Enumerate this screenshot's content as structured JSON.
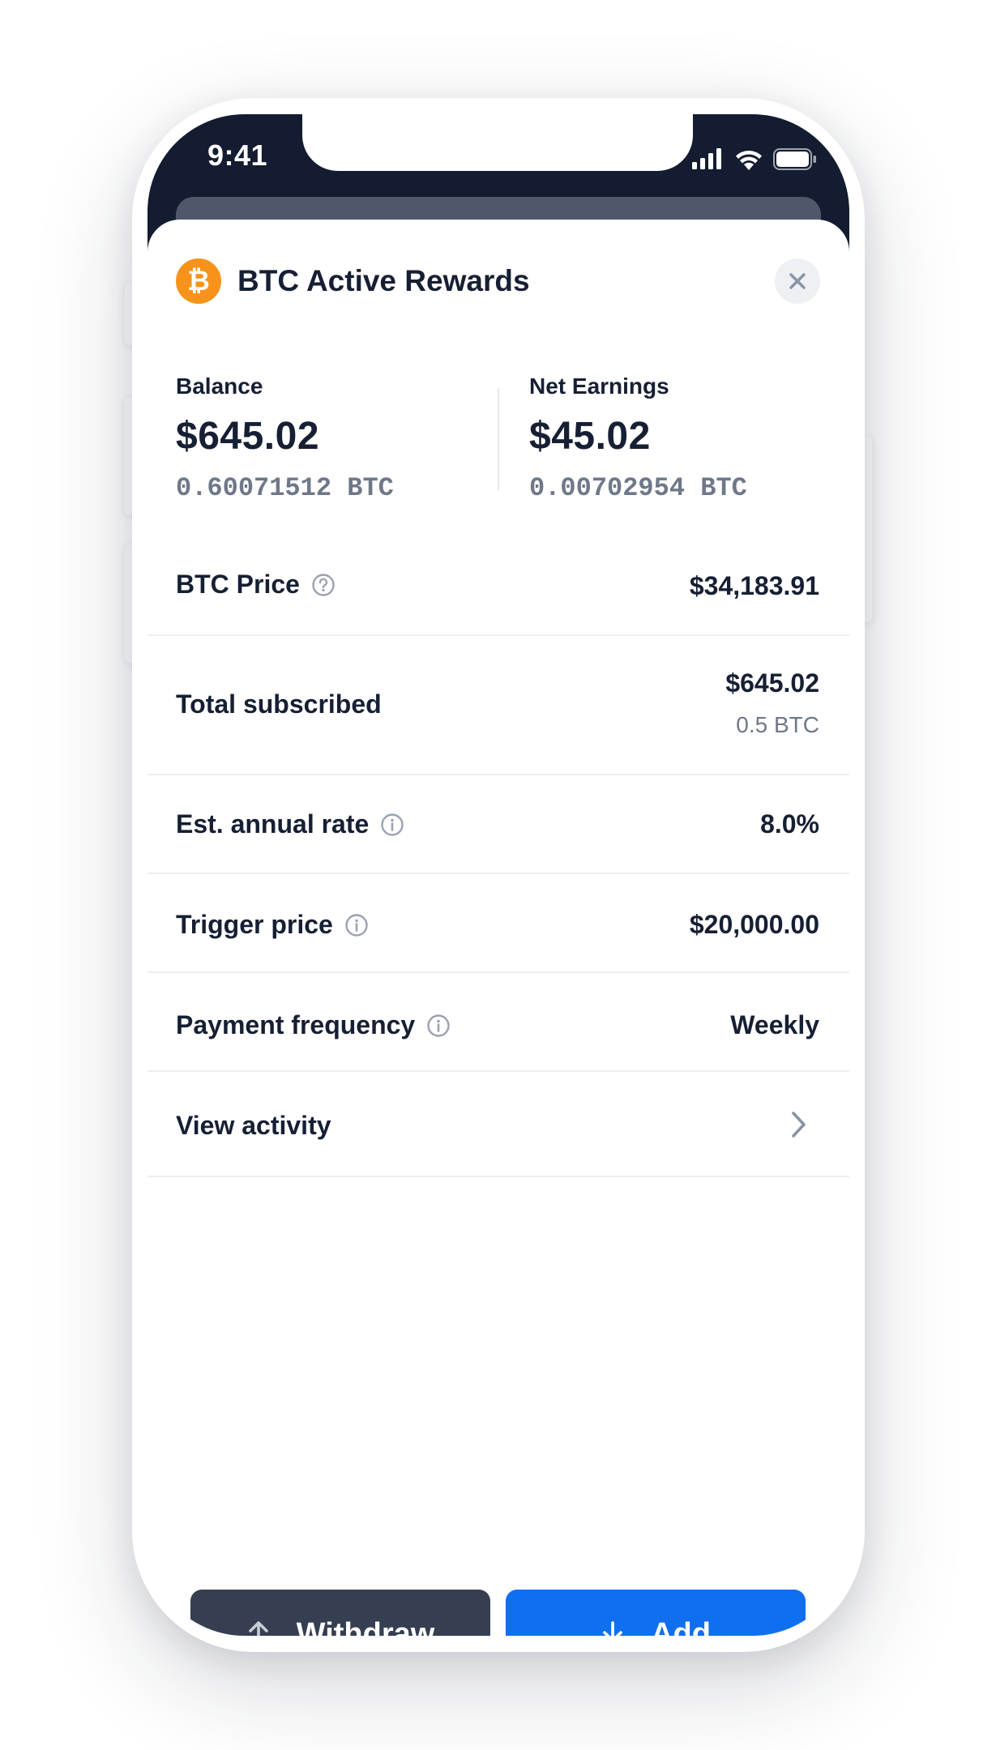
{
  "status_bar": {
    "time": "9:41"
  },
  "header": {
    "title": "BTC Active Rewards",
    "coin_symbol": "₿"
  },
  "balance": {
    "label": "Balance",
    "amount": "$645.02",
    "btc": "0.60071512 BTC"
  },
  "net_earnings": {
    "label": "Net Earnings",
    "amount": "$45.02",
    "btc": "0.00702954 BTC"
  },
  "rows": {
    "btc_price": {
      "label": "BTC Price",
      "value": "$34,183.91"
    },
    "total_subscribed": {
      "label": "Total subscribed",
      "value": "$645.02",
      "sub_value": "0.5 BTC"
    },
    "annual_rate": {
      "label": "Est. annual rate",
      "value": "8.0%"
    },
    "trigger_price": {
      "label": "Trigger price",
      "value": "$20,000.00"
    },
    "payment_frequency": {
      "label": "Payment frequency",
      "value": "Weekly"
    },
    "view_activity": {
      "label": "View activity"
    }
  },
  "actions": {
    "withdraw_label": "Withdraw",
    "add_label": "Add"
  },
  "colors": {
    "status_bar_bg": "#131c30",
    "btc_orange": "#f7931a",
    "text_primary": "#161f33",
    "text_secondary": "#6f7889",
    "withdraw_bg": "#363f51",
    "add_bg": "#0f6ff0"
  },
  "icons": [
    "bitcoin-icon",
    "close-icon",
    "question-circle-icon",
    "info-circle-icon",
    "chevron-right-icon",
    "upload-icon",
    "download-icon",
    "signal-icon",
    "wifi-icon",
    "battery-icon"
  ]
}
